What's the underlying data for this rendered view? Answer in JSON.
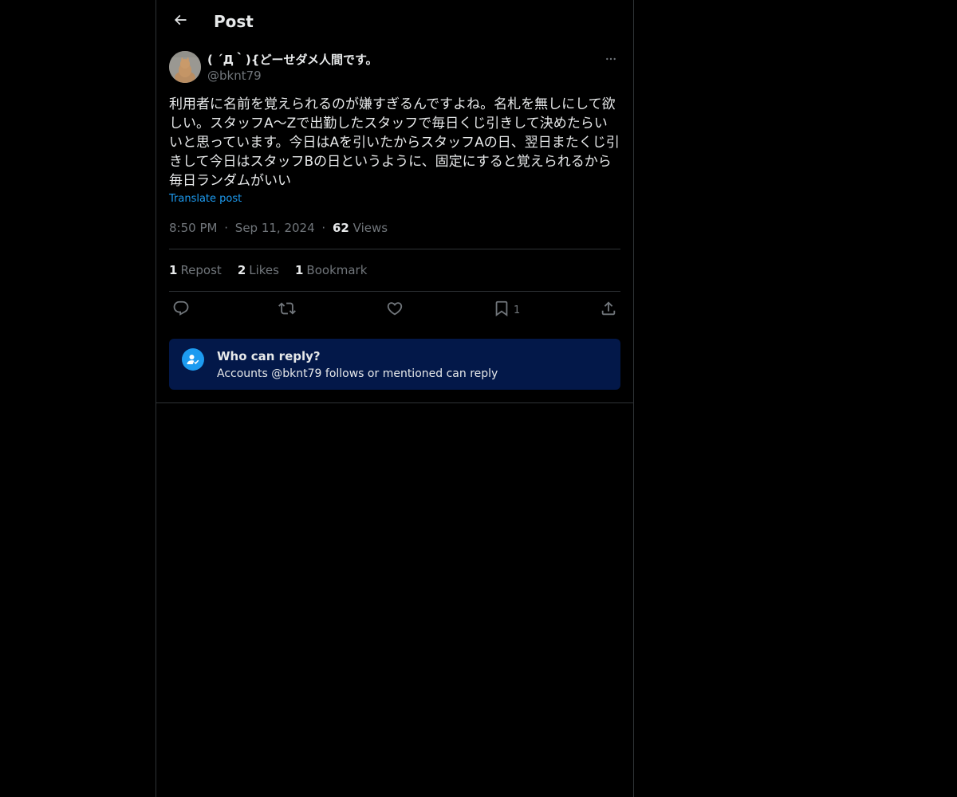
{
  "header": {
    "title": "Post",
    "back_icon": "arrow-left-icon"
  },
  "post": {
    "author": {
      "name": "( ´Д｀){どーせダメ人間です。",
      "handle": "@bknt79",
      "avatar": "cat-photo"
    },
    "text": "利用者に名前を覚えられるのが嫌すぎるんですよね。名札を無しにして欲しい。スタッフA〜Zで出勤したスタッフで毎日くじ引きして決めたらいいと思っています。今日はAを引いたからスタッフAの日、翌日またくじ引きして今日はスタッフBの日というように、固定にすると覚えられるから毎日ランダムがいい",
    "translate_label": "Translate post",
    "time": "8:50 PM",
    "sep": "·",
    "date": "Sep 11, 2024",
    "views_count": "62",
    "views_label": "Views"
  },
  "stats": {
    "reposts_count": "1",
    "reposts_label": "Repost",
    "likes_count": "2",
    "likes_label": "Likes",
    "bookmarks_count": "1",
    "bookmarks_label": "Bookmark"
  },
  "actions": {
    "reply_icon": "reply-icon",
    "repost_icon": "repost-icon",
    "like_icon": "heart-icon",
    "bookmark_icon": "bookmark-icon",
    "bookmark_count": "1",
    "share_icon": "share-icon"
  },
  "reply_restriction": {
    "title": "Who can reply?",
    "subtitle": "Accounts @bknt79 follows or mentioned can reply"
  },
  "colors": {
    "background": "#000000",
    "text": "#e7e9ea",
    "muted": "#71767b",
    "accent": "#1d9bf0",
    "border": "#2f3336",
    "reply_box": "#031849"
  }
}
